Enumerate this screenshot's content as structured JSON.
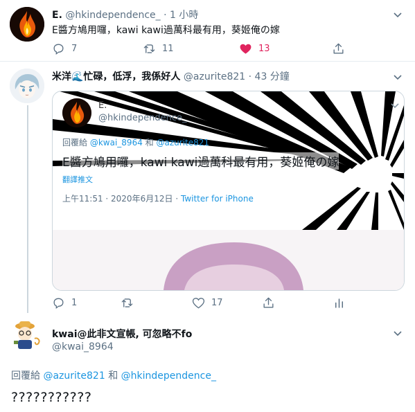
{
  "tweet1": {
    "display_name": "E.",
    "handle": "@hkindependence_",
    "separator": "·",
    "time": "1 小時",
    "text": "E醬方鳩用囉，kawi kawi過萬科最有用，葵姬俺の嫁",
    "replies": "7",
    "retweets": "11",
    "likes": "13"
  },
  "tweet2": {
    "display_name": "米洋🌊忙碌，低浮，我係好人",
    "handle": "@azurite821",
    "separator": "·",
    "time": "43 分鐘",
    "replies": "1",
    "likes": "17",
    "quoted": {
      "display_name": "E.",
      "handle": "@hkindependence_",
      "reply_to_label": "回覆給",
      "reply_to_1": "@kwai_8964",
      "reply_and": "和",
      "reply_to_2": "@azurite821",
      "text": "E醬方鳩用囉，kawi kawi過萬科最有用，葵姬俺の嫁",
      "translate": "翻譯推文",
      "timestamp": "上午11:51 · 2020年6月12日",
      "source": "Twitter for iPhone"
    }
  },
  "tweet3": {
    "display_name": "kwai@此非文宣帳, 可忽略不fo",
    "handle": "@kwai_8964",
    "reply_to_label": "回覆給",
    "reply_to_1": "@azurite821",
    "reply_and": "和",
    "reply_to_2": "@hkindependence_",
    "text": "???????????"
  },
  "colors": {
    "accent": "#1b95e0",
    "muted": "#5b7083",
    "like_active": "#e0245e",
    "border": "#e6ecf0"
  },
  "icons": [
    "chevron-down-icon",
    "reply-icon",
    "retweet-icon",
    "like-icon",
    "share-icon",
    "analytics-icon",
    "fire-avatar-icon"
  ]
}
